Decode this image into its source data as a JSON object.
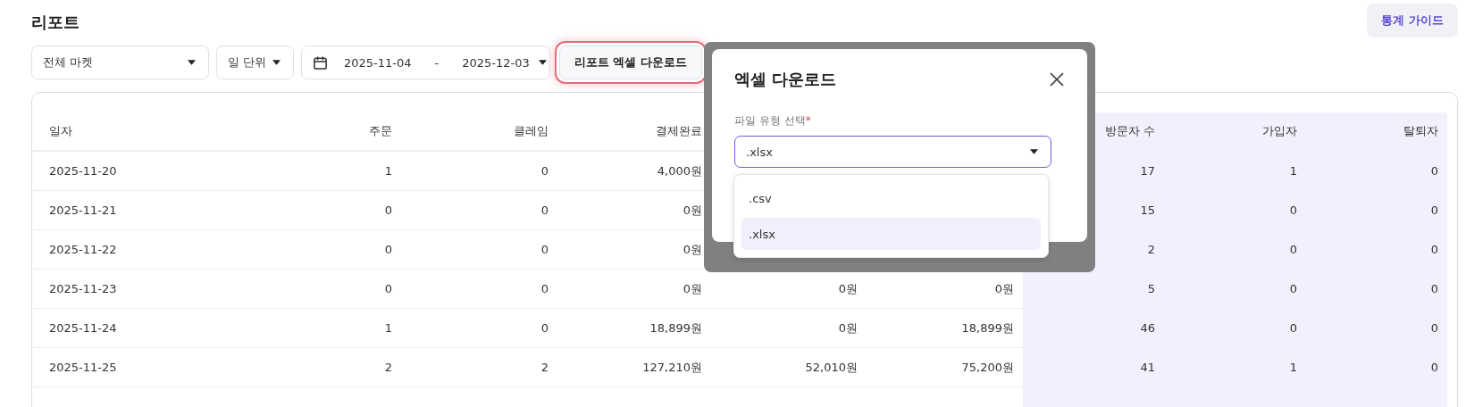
{
  "page": {
    "title": "리포트"
  },
  "guide_button": {
    "label": "통계 가이드"
  },
  "filters": {
    "market": "전체 마켓",
    "period": "일 단위",
    "date_from": "2025-11-04",
    "date_separator": "-",
    "date_to": "2025-12-03"
  },
  "export_button": {
    "label": "리포트 엑셀 다운로드",
    "focused": true
  },
  "table": {
    "columns": [
      {
        "label": "일자",
        "highlighted": false
      },
      {
        "label": "주문",
        "highlighted": false
      },
      {
        "label": "클레임",
        "highlighted": false
      },
      {
        "label": "결제완료",
        "highlighted": false
      },
      {},
      {},
      {
        "label": "방문자 수",
        "highlighted": true
      },
      {
        "label": "가입자",
        "highlighted": true
      },
      {
        "label": "탈퇴자",
        "highlighted": true
      }
    ],
    "rows": [
      {
        "cells": [
          "2025-11-20",
          "1",
          "0",
          "4,000원",
          null,
          null,
          "17",
          "1",
          "0"
        ]
      },
      {
        "cells": [
          "2025-11-21",
          "0",
          "0",
          "0원",
          null,
          null,
          "15",
          "0",
          "0"
        ]
      },
      {
        "cells": [
          "2025-11-22",
          "0",
          "0",
          "0원",
          null,
          null,
          "2",
          "0",
          "0"
        ]
      },
      {
        "cells": [
          "2025-11-23",
          "0",
          "0",
          "0원",
          "0원",
          "0원",
          "5",
          "0",
          "0"
        ]
      },
      {
        "cells": [
          "2025-11-24",
          "1",
          "0",
          "18,899원",
          "0원",
          "18,899원",
          "46",
          "0",
          "0"
        ]
      },
      {
        "cells": [
          "2025-11-25",
          "2",
          "2",
          "127,210원",
          "52,010원",
          "75,200원",
          "41",
          "1",
          "0"
        ]
      }
    ]
  },
  "dialog": {
    "title": "엑셀 다운로드",
    "field_label": "파일 유형 선택",
    "required_mark": "*",
    "value": ".xlsx",
    "options": [
      {
        "label": ".csv",
        "selected": false
      },
      {
        "label": ".xlsx",
        "selected": true
      }
    ]
  }
}
